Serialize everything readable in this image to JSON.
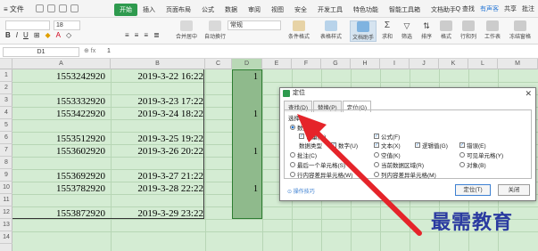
{
  "menubar": {
    "file": "≡ 文件",
    "tabs": [
      "开始",
      "插入",
      "页面布局",
      "公式",
      "数据",
      "审阅",
      "视图",
      "安全",
      "开发工具",
      "特色功能",
      "智能工具箱",
      "文档助手"
    ],
    "search": "Q 查找",
    "right": [
      "有声客",
      "共享",
      "批注"
    ]
  },
  "toolbar": {
    "font_size": "18",
    "number_format": "常规",
    "groups": [
      "合并居中",
      "自动换行",
      "条件格式",
      "表格样式",
      "文档助手",
      "求和",
      "筛选",
      "排序",
      "格式",
      "行和列",
      "工作表",
      "冻结窗格"
    ]
  },
  "formula_bar": {
    "name_box": "D1",
    "icons": "⊕ fx",
    "value": "1"
  },
  "columns": [
    "A",
    "B",
    "C",
    "D",
    "E",
    "F",
    "G",
    "H",
    "I",
    "J",
    "K",
    "L",
    "M"
  ],
  "rows": [
    "1",
    "2",
    "3",
    "4",
    "5",
    "6",
    "7",
    "8",
    "9",
    "10",
    "11",
    "12",
    "13",
    "14"
  ],
  "cells": {
    "r1": {
      "a": "1553242920",
      "b": "2019-3-22 16:22",
      "d": "1"
    },
    "r3": {
      "a": "1553332920",
      "b": "2019-3-23 17:22"
    },
    "r4": {
      "a": "1553422920",
      "b": "2019-3-24 18:22",
      "d": "1"
    },
    "r6": {
      "a": "1553512920",
      "b": "2019-3-25 19:22"
    },
    "r7": {
      "a": "1553602920",
      "b": "2019-3-26 20:22",
      "d": "1"
    },
    "r9": {
      "a": "1553692920",
      "b": "2019-3-27 21:22"
    },
    "r10": {
      "a": "1553782920",
      "b": "2019-3-28 22:22",
      "d": "1"
    },
    "r12": {
      "a": "1553872920",
      "b": "2019-3-29 23:22"
    }
  },
  "dialog": {
    "title": "定位",
    "tabs": [
      "查找(D)",
      "替换(P)",
      "定位(G)"
    ],
    "section": "选择",
    "opt_data": "数据(A)",
    "opt_constant": "常量(O)",
    "opt_formula": "公式(F)",
    "data_type_label": "数据类型",
    "opt_number": "数字(U)",
    "opt_text": "文本(X)",
    "opt_logical": "逻辑值(G)",
    "opt_error": "错误(E)",
    "opt_comment": "批注(C)",
    "opt_blank": "空值(K)",
    "opt_visible": "可见单元格(Y)",
    "opt_last": "最后一个单元格(S)",
    "opt_current": "当前数据区域(R)",
    "opt_object": "对象(B)",
    "opt_rowdiff": "行内容差异单元格(W)",
    "opt_coldiff": "列内容差异单元格(M)",
    "help": "⊙ 操作技巧",
    "locate_button": "定位(T)",
    "close_button": "关闭"
  },
  "watermark": "最需教育",
  "colors": {
    "accent": "#2e9a4e",
    "sheet_bg": "#d4ecd3",
    "arrow": "#e5242a"
  }
}
